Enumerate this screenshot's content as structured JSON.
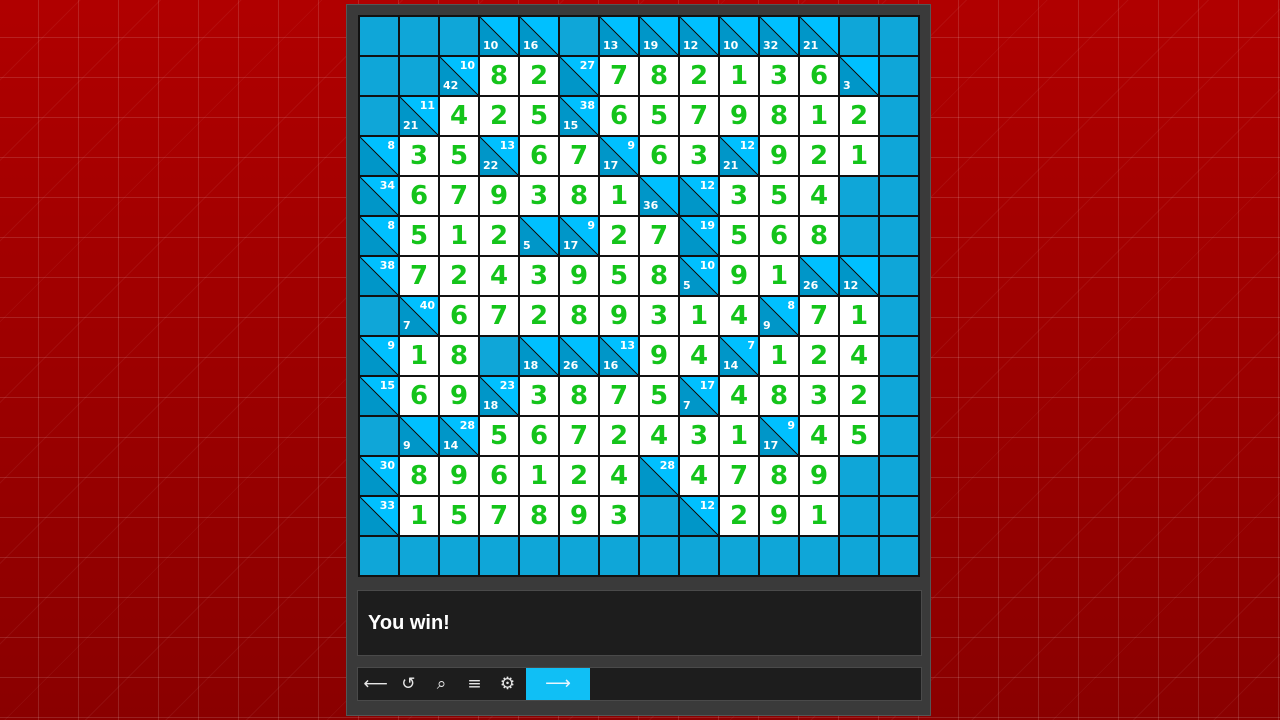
{
  "status": {
    "message": "You win!"
  },
  "colors": {
    "background": "#a80000",
    "panel": "#3a3a3a",
    "block": "#0fa6d8",
    "cell": "#ffffff",
    "digit": "#14c41a"
  },
  "toolbar": {
    "back_icon": "arrow-left-icon",
    "back_glyph": "⟵",
    "undo_icon": "undo-icon",
    "undo_glyph": "↺",
    "search_icon": "magnifier-icon",
    "search_glyph": "⌕",
    "menu_icon": "menu-icon",
    "menu_glyph": "≡",
    "settings_icon": "gear-icon",
    "settings_glyph": "⚙",
    "next_icon": "arrow-right-icon",
    "next_glyph": "⟶"
  },
  "board": {
    "size": 14,
    "rows": [
      [
        "#",
        "#",
        "#",
        "c:10|",
        "c:16|",
        "#",
        "c:13|",
        "c:19|",
        "c:12|",
        "c:10|",
        "c:32|",
        "c:21|",
        "#",
        "#"
      ],
      [
        "#",
        "#",
        "c:42|10",
        "8",
        "2",
        "c:|27",
        "7",
        "8",
        "2",
        "1",
        "3",
        "6",
        "c:3|",
        "#"
      ],
      [
        "#",
        "c:21|11",
        "4",
        "2",
        "5",
        "c:15|38",
        "6",
        "5",
        "7",
        "9",
        "8",
        "1",
        "2",
        "#"
      ],
      [
        "c:|8",
        "3",
        "5",
        "c:22|13",
        "6",
        "7",
        "c:17|9",
        "6",
        "3",
        "c:21|12",
        "9",
        "2",
        "1",
        "#"
      ],
      [
        "c:|34",
        "6",
        "7",
        "9",
        "3",
        "8",
        "1",
        "c:36|",
        "c:|12",
        "3",
        "5",
        "4",
        "#",
        "#"
      ],
      [
        "c:|8",
        "5",
        "1",
        "2",
        "c:5|",
        "c:17|9",
        "2",
        "7",
        "c:|19",
        "5",
        "6",
        "8",
        "#",
        "#"
      ],
      [
        "c:|38",
        "7",
        "2",
        "4",
        "3",
        "9",
        "5",
        "8",
        "c:5|10",
        "9",
        "1",
        "c:26|",
        "c:12|",
        "#"
      ],
      [
        "#",
        "c:7|40",
        "6",
        "7",
        "2",
        "8",
        "9",
        "3",
        "1",
        "4",
        "c:9|8",
        "7",
        "1",
        "#"
      ],
      [
        "c:|9",
        "1",
        "8",
        "#",
        "c:18|",
        "c:26|",
        "c:16|13",
        "9",
        "4",
        "c:14|7",
        "1",
        "2",
        "4",
        "#"
      ],
      [
        "c:|15",
        "6",
        "9",
        "c:18|23",
        "3",
        "8",
        "7",
        "5",
        "c:7|17",
        "4",
        "8",
        "3",
        "2",
        "#"
      ],
      [
        "#",
        "c:9|",
        "c:14|28",
        "5",
        "6",
        "7",
        "2",
        "4",
        "3",
        "1",
        "c:17|9",
        "4",
        "5",
        "#"
      ],
      [
        "c:|30",
        "8",
        "9",
        "6",
        "1",
        "2",
        "4",
        "c:|28",
        "4",
        "7",
        "8",
        "9",
        "#",
        "#"
      ],
      [
        "c:|33",
        "1",
        "5",
        "7",
        "8",
        "9",
        "3",
        "#",
        "c:|12",
        "2",
        "9",
        "1",
        "#",
        "#"
      ],
      [
        "#",
        "#",
        "#",
        "#",
        "#",
        "#",
        "#",
        "#",
        "#",
        "#",
        "#",
        "#",
        "#",
        "#"
      ]
    ]
  }
}
